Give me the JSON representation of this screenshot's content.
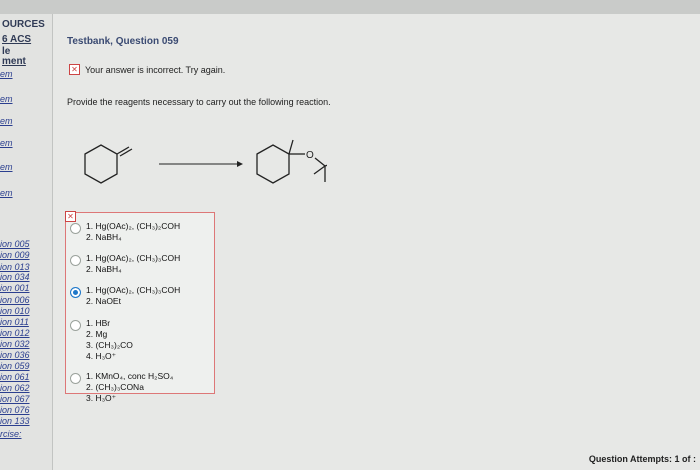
{
  "sidebar": {
    "title_line1": "OURCES",
    "title_line2": "6 ACS",
    "title_line3": "le",
    "title_line4": "ment",
    "items": [
      "em",
      "em",
      "em",
      "em",
      "em",
      "em",
      "ion 005",
      "ion 009",
      "ion 013",
      "ion 034",
      "ion 001",
      "ion 006",
      "ion 010",
      "ion 011",
      "ion 012",
      "ion 032",
      "ion 036",
      "ion 059",
      "ion 061",
      "ion 062",
      "ion 067",
      "ion 076",
      "ion 133",
      "rcise:"
    ]
  },
  "question": {
    "title": "Testbank, Question 059",
    "feedback": "Your answer is incorrect.  Try again.",
    "prompt": "Provide the reagents necessary to carry out the following reaction.",
    "reaction_label": "O"
  },
  "options": [
    {
      "lines": [
        "1. Hg(OAc)₂, (CH₃)₂COH",
        "2. NaBH₄"
      ],
      "selected": false
    },
    {
      "lines": [
        "1. Hg(OAc)₂, (CH₃)₃COH",
        "2. NaBH₄"
      ],
      "selected": false
    },
    {
      "lines": [
        "1. Hg(OAc)₂, (CH₃)₃COH",
        "2. NaOEt"
      ],
      "selected": true
    },
    {
      "lines": [
        "1. HBr",
        "2. Mg",
        "3. (CH₃)₂CO",
        "4. H₃O⁺"
      ],
      "selected": false
    },
    {
      "lines": [
        "1. KMnO₄, conc H₂SO₄",
        "2. (CH₃)₃CONa",
        "3. H₃O⁺"
      ],
      "selected": false
    }
  ],
  "footer": {
    "attempts": "Question Attempts: 1 of :"
  }
}
